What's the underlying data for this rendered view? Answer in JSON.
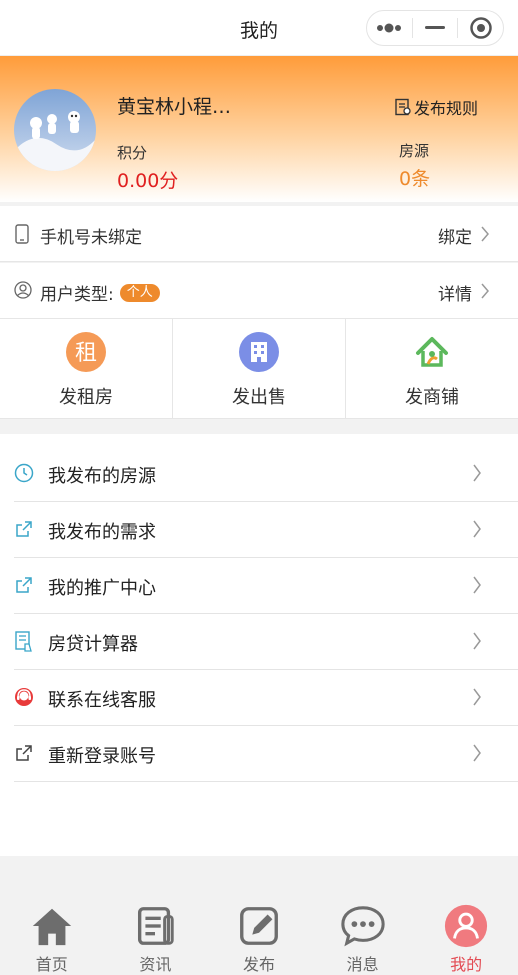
{
  "nav": {
    "title": "我的"
  },
  "profile": {
    "username": "黄宝林小程…",
    "rules_label": "发布规则",
    "points_label": "积分",
    "points_value": "0.00分",
    "houses_label": "房源",
    "houses_value": "0条"
  },
  "phone_row": {
    "label": "手机号未绑定",
    "action": "绑定"
  },
  "usertype_row": {
    "label": "用户类型:",
    "badge": "个人",
    "action": "详情"
  },
  "quick_actions": [
    {
      "label": "发租房",
      "icon": "rent-icon",
      "color": "#f59a56"
    },
    {
      "label": "发出售",
      "icon": "building-icon",
      "color": "#7b8ee6"
    },
    {
      "label": "发商铺",
      "icon": "shop-icon",
      "color": "#5cb85c"
    }
  ],
  "menu": [
    {
      "label": "我发布的房源",
      "icon": "clock-icon"
    },
    {
      "label": "我发布的需求",
      "icon": "share-icon"
    },
    {
      "label": "我的推广中心",
      "icon": "share-icon"
    },
    {
      "label": "房贷计算器",
      "icon": "calculator-icon"
    },
    {
      "label": "联系在线客服",
      "icon": "customer-service-icon"
    },
    {
      "label": "重新登录账号",
      "icon": "relogin-icon"
    }
  ],
  "tabs": [
    {
      "label": "首页",
      "icon": "home-icon"
    },
    {
      "label": "资讯",
      "icon": "news-icon"
    },
    {
      "label": "发布",
      "icon": "edit-icon"
    },
    {
      "label": "消息",
      "icon": "message-icon"
    },
    {
      "label": "我的",
      "icon": "user-icon",
      "active": true
    }
  ],
  "colors": {
    "accent": "#ee8a2c",
    "red": "#e02020",
    "active_tab": "#e34c54"
  }
}
